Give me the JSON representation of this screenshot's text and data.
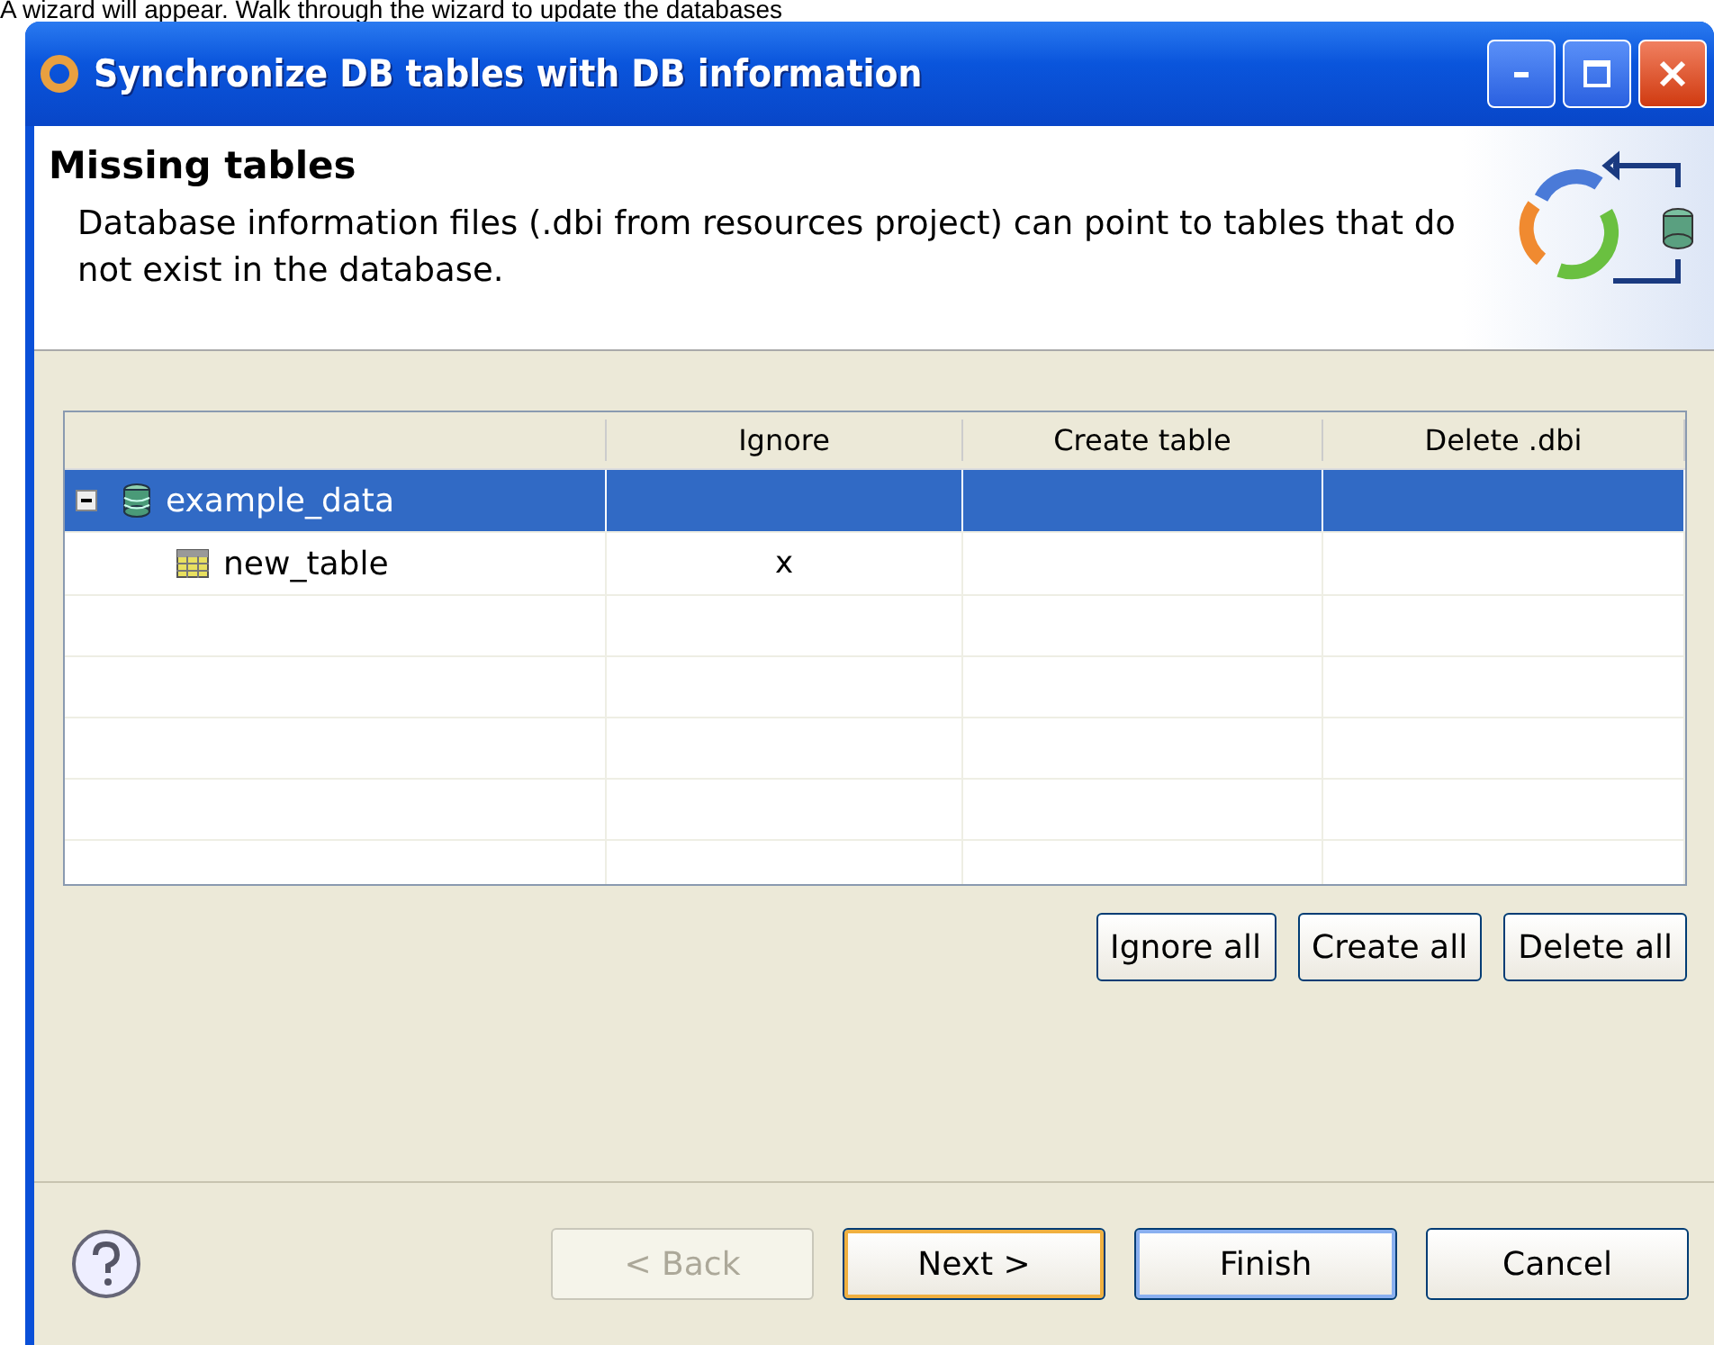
{
  "caption": "A wizard will appear. Walk through the wizard to update the databases",
  "window": {
    "title": "Synchronize DB tables with DB information"
  },
  "header": {
    "title": "Missing tables",
    "description": "Database information files (.dbi from resources project) can point to tables that do not exist in the database."
  },
  "table": {
    "columns": [
      "Ignore",
      "Create table",
      "Delete .dbi"
    ],
    "rows": [
      {
        "kind": "database",
        "name": "example_data",
        "selected": true,
        "expanded": true,
        "cells": [],
        "children": [
          {
            "kind": "table",
            "name": "new_table",
            "selected": false,
            "cells": [
              "x"
            ]
          }
        ]
      }
    ]
  },
  "action_buttons": [
    "Ignore all",
    "Create all",
    "Delete all"
  ],
  "footer_buttons": [
    {
      "label": "< Back",
      "disabled": true,
      "focused": false,
      "default": false
    },
    {
      "label": "Next >",
      "disabled": false,
      "focused": true,
      "default": false
    },
    {
      "label": "Finish",
      "disabled": false,
      "focused": false,
      "default": true
    },
    {
      "label": "Cancel",
      "disabled": false,
      "focused": false,
      "default": false
    }
  ]
}
